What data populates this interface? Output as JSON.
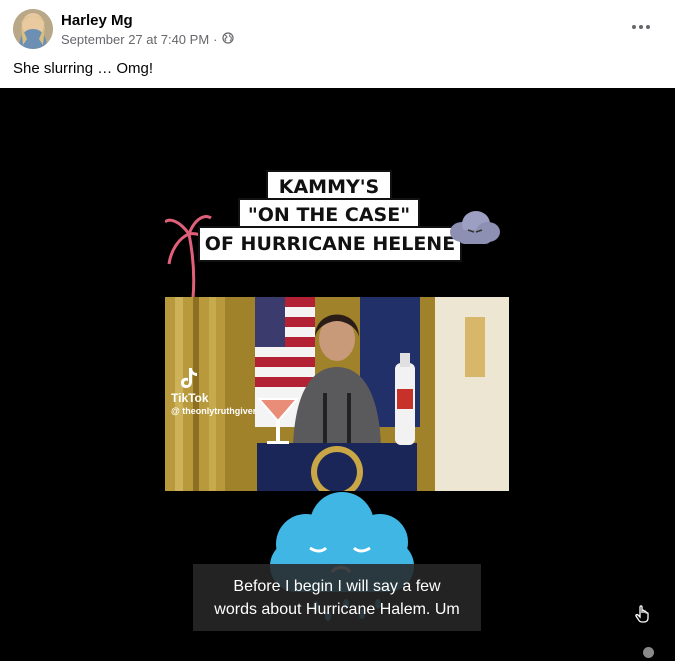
{
  "post": {
    "author": "Harley Mg",
    "timestamp": "September 27 at 7:40 PM",
    "separator": "·",
    "privacy_icon": "globe-icon",
    "caption": "She slurring … Omg!"
  },
  "video": {
    "title_line1": "KAMMY'S",
    "title_line2": "\"ON THE CASE\"",
    "title_line3": "OF HURRICANE HELENE",
    "watermark_brand": "TikTok",
    "watermark_handle": "@ theonlytruthgiver",
    "subtitle_line1": "Before I begin I will say a few",
    "subtitle_line2": "words about Hurricane Halem. Um",
    "controls": {
      "hand_icon": "pointer-hand-icon"
    }
  },
  "colors": {
    "background": "#000000",
    "cloud": "#3fb6e3",
    "palm": "#e0607a"
  }
}
